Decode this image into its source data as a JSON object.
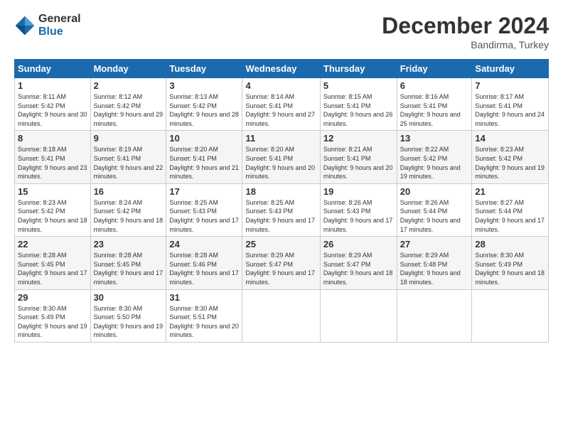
{
  "header": {
    "logo_general": "General",
    "logo_blue": "Blue",
    "month_title": "December 2024",
    "location": "Bandirma, Turkey"
  },
  "weekdays": [
    "Sunday",
    "Monday",
    "Tuesday",
    "Wednesday",
    "Thursday",
    "Friday",
    "Saturday"
  ],
  "weeks": [
    [
      {
        "day": "1",
        "sunrise": "Sunrise: 8:11 AM",
        "sunset": "Sunset: 5:42 PM",
        "daylight": "Daylight: 9 hours and 30 minutes."
      },
      {
        "day": "2",
        "sunrise": "Sunrise: 8:12 AM",
        "sunset": "Sunset: 5:42 PM",
        "daylight": "Daylight: 9 hours and 29 minutes."
      },
      {
        "day": "3",
        "sunrise": "Sunrise: 8:13 AM",
        "sunset": "Sunset: 5:42 PM",
        "daylight": "Daylight: 9 hours and 28 minutes."
      },
      {
        "day": "4",
        "sunrise": "Sunrise: 8:14 AM",
        "sunset": "Sunset: 5:41 PM",
        "daylight": "Daylight: 9 hours and 27 minutes."
      },
      {
        "day": "5",
        "sunrise": "Sunrise: 8:15 AM",
        "sunset": "Sunset: 5:41 PM",
        "daylight": "Daylight: 9 hours and 26 minutes."
      },
      {
        "day": "6",
        "sunrise": "Sunrise: 8:16 AM",
        "sunset": "Sunset: 5:41 PM",
        "daylight": "Daylight: 9 hours and 25 minutes."
      },
      {
        "day": "7",
        "sunrise": "Sunrise: 8:17 AM",
        "sunset": "Sunset: 5:41 PM",
        "daylight": "Daylight: 9 hours and 24 minutes."
      }
    ],
    [
      {
        "day": "8",
        "sunrise": "Sunrise: 8:18 AM",
        "sunset": "Sunset: 5:41 PM",
        "daylight": "Daylight: 9 hours and 23 minutes."
      },
      {
        "day": "9",
        "sunrise": "Sunrise: 8:19 AM",
        "sunset": "Sunset: 5:41 PM",
        "daylight": "Daylight: 9 hours and 22 minutes."
      },
      {
        "day": "10",
        "sunrise": "Sunrise: 8:20 AM",
        "sunset": "Sunset: 5:41 PM",
        "daylight": "Daylight: 9 hours and 21 minutes."
      },
      {
        "day": "11",
        "sunrise": "Sunrise: 8:20 AM",
        "sunset": "Sunset: 5:41 PM",
        "daylight": "Daylight: 9 hours and 20 minutes."
      },
      {
        "day": "12",
        "sunrise": "Sunrise: 8:21 AM",
        "sunset": "Sunset: 5:41 PM",
        "daylight": "Daylight: 9 hours and 20 minutes."
      },
      {
        "day": "13",
        "sunrise": "Sunrise: 8:22 AM",
        "sunset": "Sunset: 5:42 PM",
        "daylight": "Daylight: 9 hours and 19 minutes."
      },
      {
        "day": "14",
        "sunrise": "Sunrise: 8:23 AM",
        "sunset": "Sunset: 5:42 PM",
        "daylight": "Daylight: 9 hours and 19 minutes."
      }
    ],
    [
      {
        "day": "15",
        "sunrise": "Sunrise: 8:23 AM",
        "sunset": "Sunset: 5:42 PM",
        "daylight": "Daylight: 9 hours and 18 minutes."
      },
      {
        "day": "16",
        "sunrise": "Sunrise: 8:24 AM",
        "sunset": "Sunset: 5:42 PM",
        "daylight": "Daylight: 9 hours and 18 minutes."
      },
      {
        "day": "17",
        "sunrise": "Sunrise: 8:25 AM",
        "sunset": "Sunset: 5:43 PM",
        "daylight": "Daylight: 9 hours and 17 minutes."
      },
      {
        "day": "18",
        "sunrise": "Sunrise: 8:25 AM",
        "sunset": "Sunset: 5:43 PM",
        "daylight": "Daylight: 9 hours and 17 minutes."
      },
      {
        "day": "19",
        "sunrise": "Sunrise: 8:26 AM",
        "sunset": "Sunset: 5:43 PM",
        "daylight": "Daylight: 9 hours and 17 minutes."
      },
      {
        "day": "20",
        "sunrise": "Sunrise: 8:26 AM",
        "sunset": "Sunset: 5:44 PM",
        "daylight": "Daylight: 9 hours and 17 minutes."
      },
      {
        "day": "21",
        "sunrise": "Sunrise: 8:27 AM",
        "sunset": "Sunset: 5:44 PM",
        "daylight": "Daylight: 9 hours and 17 minutes."
      }
    ],
    [
      {
        "day": "22",
        "sunrise": "Sunrise: 8:28 AM",
        "sunset": "Sunset: 5:45 PM",
        "daylight": "Daylight: 9 hours and 17 minutes."
      },
      {
        "day": "23",
        "sunrise": "Sunrise: 8:28 AM",
        "sunset": "Sunset: 5:45 PM",
        "daylight": "Daylight: 9 hours and 17 minutes."
      },
      {
        "day": "24",
        "sunrise": "Sunrise: 8:28 AM",
        "sunset": "Sunset: 5:46 PM",
        "daylight": "Daylight: 9 hours and 17 minutes."
      },
      {
        "day": "25",
        "sunrise": "Sunrise: 8:29 AM",
        "sunset": "Sunset: 5:47 PM",
        "daylight": "Daylight: 9 hours and 17 minutes."
      },
      {
        "day": "26",
        "sunrise": "Sunrise: 8:29 AM",
        "sunset": "Sunset: 5:47 PM",
        "daylight": "Daylight: 9 hours and 18 minutes."
      },
      {
        "day": "27",
        "sunrise": "Sunrise: 8:29 AM",
        "sunset": "Sunset: 5:48 PM",
        "daylight": "Daylight: 9 hours and 18 minutes."
      },
      {
        "day": "28",
        "sunrise": "Sunrise: 8:30 AM",
        "sunset": "Sunset: 5:49 PM",
        "daylight": "Daylight: 9 hours and 18 minutes."
      }
    ],
    [
      {
        "day": "29",
        "sunrise": "Sunrise: 8:30 AM",
        "sunset": "Sunset: 5:49 PM",
        "daylight": "Daylight: 9 hours and 19 minutes."
      },
      {
        "day": "30",
        "sunrise": "Sunrise: 8:30 AM",
        "sunset": "Sunset: 5:50 PM",
        "daylight": "Daylight: 9 hours and 19 minutes."
      },
      {
        "day": "31",
        "sunrise": "Sunrise: 8:30 AM",
        "sunset": "Sunset: 5:51 PM",
        "daylight": "Daylight: 9 hours and 20 minutes."
      },
      null,
      null,
      null,
      null
    ]
  ]
}
